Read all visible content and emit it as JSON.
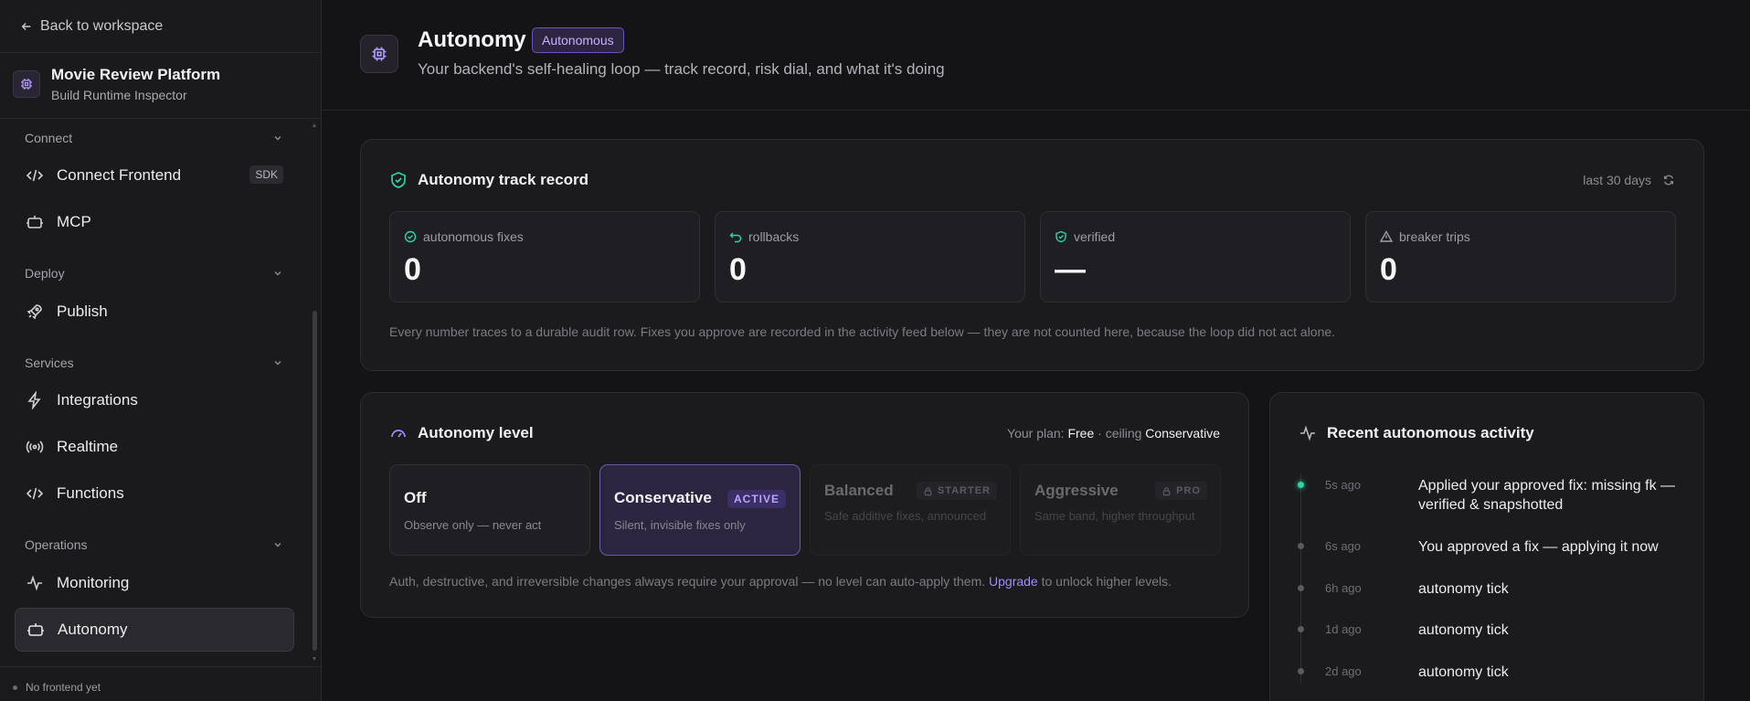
{
  "sidebar": {
    "back_label": "Back to workspace",
    "project": {
      "name": "Movie Review Platform",
      "subtitle": "Build Runtime Inspector"
    },
    "sections": [
      {
        "label": "Connect",
        "items": [
          {
            "label": "Connect Frontend",
            "icon": "code-icon",
            "badge": "SDK"
          },
          {
            "label": "MCP",
            "icon": "bot-icon"
          }
        ]
      },
      {
        "label": "Deploy",
        "items": [
          {
            "label": "Publish",
            "icon": "rocket-icon"
          }
        ]
      },
      {
        "label": "Services",
        "items": [
          {
            "label": "Integrations",
            "icon": "bolt-icon"
          },
          {
            "label": "Realtime",
            "icon": "broadcast-icon"
          },
          {
            "label": "Functions",
            "icon": "code-icon"
          }
        ]
      },
      {
        "label": "Operations",
        "items": [
          {
            "label": "Monitoring",
            "icon": "activity-icon"
          },
          {
            "label": "Autonomy",
            "icon": "bot-icon",
            "active": true
          }
        ]
      }
    ],
    "footer": "No frontend yet"
  },
  "header": {
    "title": "Autonomy",
    "badge": "Autonomous",
    "subtitle": "Your backend's self-healing loop — track record, risk dial, and what it's doing"
  },
  "track_record": {
    "title": "Autonomy track record",
    "range": "last 30 days",
    "stats": [
      {
        "label": "autonomous fixes",
        "value": "0",
        "icon": "check-circle-icon"
      },
      {
        "label": "rollbacks",
        "value": "0",
        "icon": "undo-icon"
      },
      {
        "label": "verified",
        "value": "—",
        "icon": "shield-check-icon"
      },
      {
        "label": "breaker trips",
        "value": "0",
        "icon": "warning-icon"
      }
    ],
    "note": "Every number traces to a durable audit row. Fixes you approve are recorded in the activity feed below — they are not counted here, because the loop did not act alone."
  },
  "autonomy_level": {
    "title": "Autonomy level",
    "plan_prefix": "Your plan:",
    "plan": "Free",
    "ceiling_prefix": "· ceiling",
    "ceiling": "Conservative",
    "levels": [
      {
        "name": "Off",
        "desc": "Observe only — never act"
      },
      {
        "name": "Conservative",
        "desc": "Silent, invisible fixes only",
        "badge": "ACTIVE"
      },
      {
        "name": "Balanced",
        "desc": "Safe additive fixes, announced",
        "lock": "STARTER"
      },
      {
        "name": "Aggressive",
        "desc": "Same band, higher throughput",
        "lock": "PRO"
      }
    ],
    "note_before": "Auth, destructive, and irreversible changes always require your approval — no level can auto-apply them.",
    "note_link": "Upgrade",
    "note_after": "to unlock higher levels."
  },
  "activity": {
    "title": "Recent autonomous activity",
    "items": [
      {
        "time": "5s ago",
        "text": "Applied your approved fix: missing fk — verified & snapshotted"
      },
      {
        "time": "6s ago",
        "text": "You approved a fix — applying it now"
      },
      {
        "time": "6h ago",
        "text": "autonomy tick"
      },
      {
        "time": "1d ago",
        "text": "autonomy tick"
      },
      {
        "time": "2d ago",
        "text": "autonomy tick"
      }
    ]
  },
  "colors": {
    "accent": "#8b6cf6",
    "live": "#2dd4a6",
    "shield": "#2dd4a6"
  }
}
